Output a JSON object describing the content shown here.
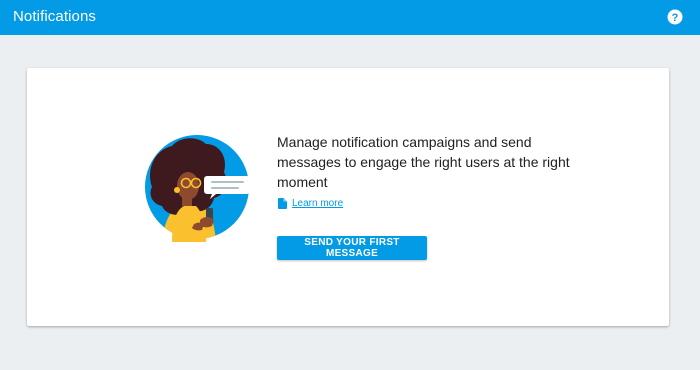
{
  "header": {
    "title": "Notifications",
    "help_icon": "help-circle-icon",
    "background_color": "#039be5"
  },
  "empty_state": {
    "illustration": "person-with-phone-and-chat-bubble",
    "headline": "Manage notification campaigns and send messages to engage the right users at the right moment",
    "learn_more_icon": "document-icon",
    "learn_more_label": "Learn more",
    "cta_label": "SEND YOUR FIRST MESSAGE"
  },
  "colors": {
    "accent": "#039be5",
    "page_background": "#eceff1",
    "card_background": "#ffffff",
    "text": "#212121"
  }
}
